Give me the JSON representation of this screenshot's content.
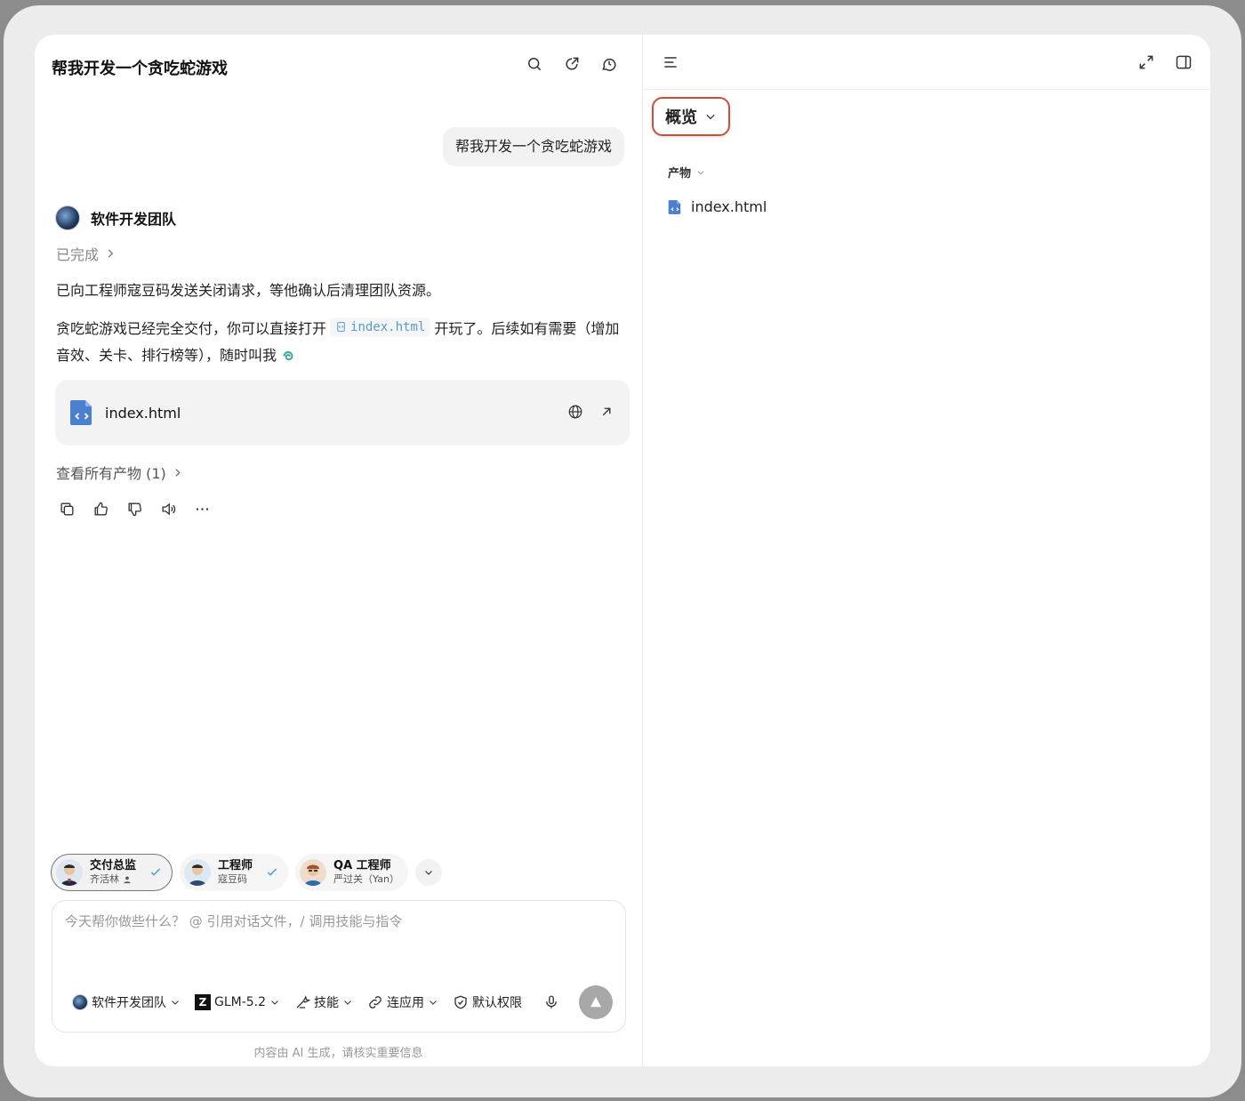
{
  "chat": {
    "title": "帮我开发一个贪吃蛇游戏",
    "user_message": "帮我开发一个贪吃蛇游戏",
    "agent_name": "软件开发团队",
    "status": "已完成",
    "paragraph1": "已向工程师寇豆码发送关闭请求，等他确认后清理团队资源。",
    "paragraph2_before": "贪吃蛇游戏已经完全交付，你可以直接打开",
    "paragraph2_code": "index.html",
    "paragraph2_after": "开玩了。后续如有需要（增加音效、关卡、排行榜等），随时叫我",
    "file_card_name": "index.html",
    "view_all": "查看所有产物 (1)"
  },
  "agents": [
    {
      "role": "交付总监",
      "name": "齐活林",
      "active": true
    },
    {
      "role": "工程师",
      "name": "寇豆码",
      "active": false
    },
    {
      "role": "QA 工程师",
      "name": "严过关（Yan）",
      "active": false
    }
  ],
  "composer": {
    "placeholder": "今天帮你做些什么？ @ 引用对话文件，/ 调用技能与指令",
    "team": "软件开发团队",
    "model": "GLM-5.2",
    "model_logo": "Z",
    "skills": "技能",
    "connect": "连应用",
    "permissions": "默认权限"
  },
  "disclaimer": "内容由 AI 生成，请核实重要信息",
  "right_panel": {
    "overview": "概览",
    "artifacts_label": "产物",
    "file": "index.html"
  },
  "colors": {
    "highlight_border": "#c8503b",
    "file_icon": "#4a7fd1",
    "code_text": "#5a9bc2",
    "check": "#4aa3c7"
  }
}
